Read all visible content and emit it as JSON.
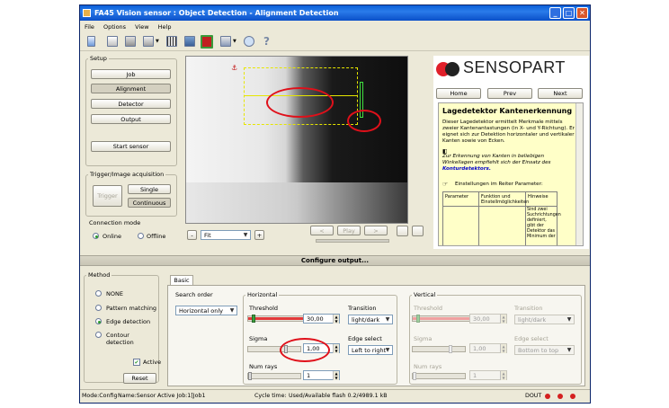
{
  "window": {
    "title": "FA45 Vision sensor : Object Detection - Alignment Detection",
    "min": "_",
    "max": "□",
    "close": "✕"
  },
  "menu": [
    "File",
    "Options",
    "View",
    "Help"
  ],
  "setup": {
    "label": "Setup",
    "buttons": [
      "Job",
      "Alignment",
      "Detector",
      "Output"
    ],
    "start": "Start sensor"
  },
  "trigger": {
    "label": "Trigger/Image acquisition",
    "trigger": "Trigger",
    "single": "Single",
    "continuous": "Continuous"
  },
  "connection": {
    "label": "Connection mode",
    "online": "Online",
    "offline": "Offline"
  },
  "imagebar": {
    "minus": "-",
    "zoom": "Fit",
    "plus": "+",
    "prev": "<",
    "play": "Play",
    "next": ">"
  },
  "help": {
    "logo": "SENSOPART",
    "nav": [
      "Home",
      "Prev",
      "Next"
    ],
    "heading": "Lagedetektor Kantenerkennung",
    "p1": "Dieser Lagedetektor ermittelt Merkmale mittels zweier Kantenantastungen (in X- und Y-Richtung). Er eignet sich zur Detektion horizontaler und vertikaler Kanten sowie von Ecken.",
    "p2a": "Zur Erkennung von Kanten in beliebigen Winkellagen empfiehlt sich der Einsatz des",
    "p2b": "Konturdetektors.",
    "p3": "Einstellungen im Reiter Parameter:",
    "th": [
      "Parameter",
      "Funktion und Einstellmöglichkeiten",
      "Hinweise"
    ],
    "cell": "Sind zwei Suchrichtungen definiert, gibt der Detektor das Minimum der"
  },
  "configure": "Configure output...",
  "method": {
    "label": "Method",
    "options": [
      "NONE",
      "Pattern matching",
      "Edge detection",
      "Contour detection"
    ],
    "selected": 2,
    "active": "Active",
    "reset": "Reset"
  },
  "tab": "Basic",
  "search_order": {
    "label": "Search order",
    "value": "Horizontal only"
  },
  "horizontal": {
    "label": "Horizontal",
    "threshold_label": "Threshold",
    "threshold": "30,00",
    "sigma_label": "Sigma",
    "sigma": "1,00",
    "numrays_label": "Num rays",
    "numrays": "1",
    "transition_label": "Transition",
    "transition": "light/dark",
    "edge_label": "Edge select",
    "edge": "Left to right"
  },
  "vertical": {
    "label": "Vertical",
    "threshold_label": "Threshold",
    "threshold": "30,00",
    "sigma_label": "Sigma",
    "sigma": "1,00",
    "numrays_label": "Num rays",
    "numrays": "1",
    "transition_label": "Transition",
    "transition": "light/dark",
    "edge_label": "Edge select",
    "edge": "Bottom to top"
  },
  "status": {
    "mode": "Mode:Config",
    "name": "Name:Sensor",
    "job": "Active Job:1[Job1",
    "cycle": "Cycle time:",
    "flash": "Used/Available flash 0.2/4989.1 kB",
    "dout": "DOUT"
  },
  "colors": {
    "titlebar": "#0a5fd8",
    "highlight": "#e0101a",
    "help_bg": "#ffffc8",
    "dout_led": "#d42020"
  },
  "icons": [
    "new-icon",
    "open-icon",
    "save-icon",
    "copy-icon",
    "sensor-icon",
    "camera-icon",
    "record-icon",
    "chart-icon",
    "zoom-icon",
    "help-icon"
  ]
}
